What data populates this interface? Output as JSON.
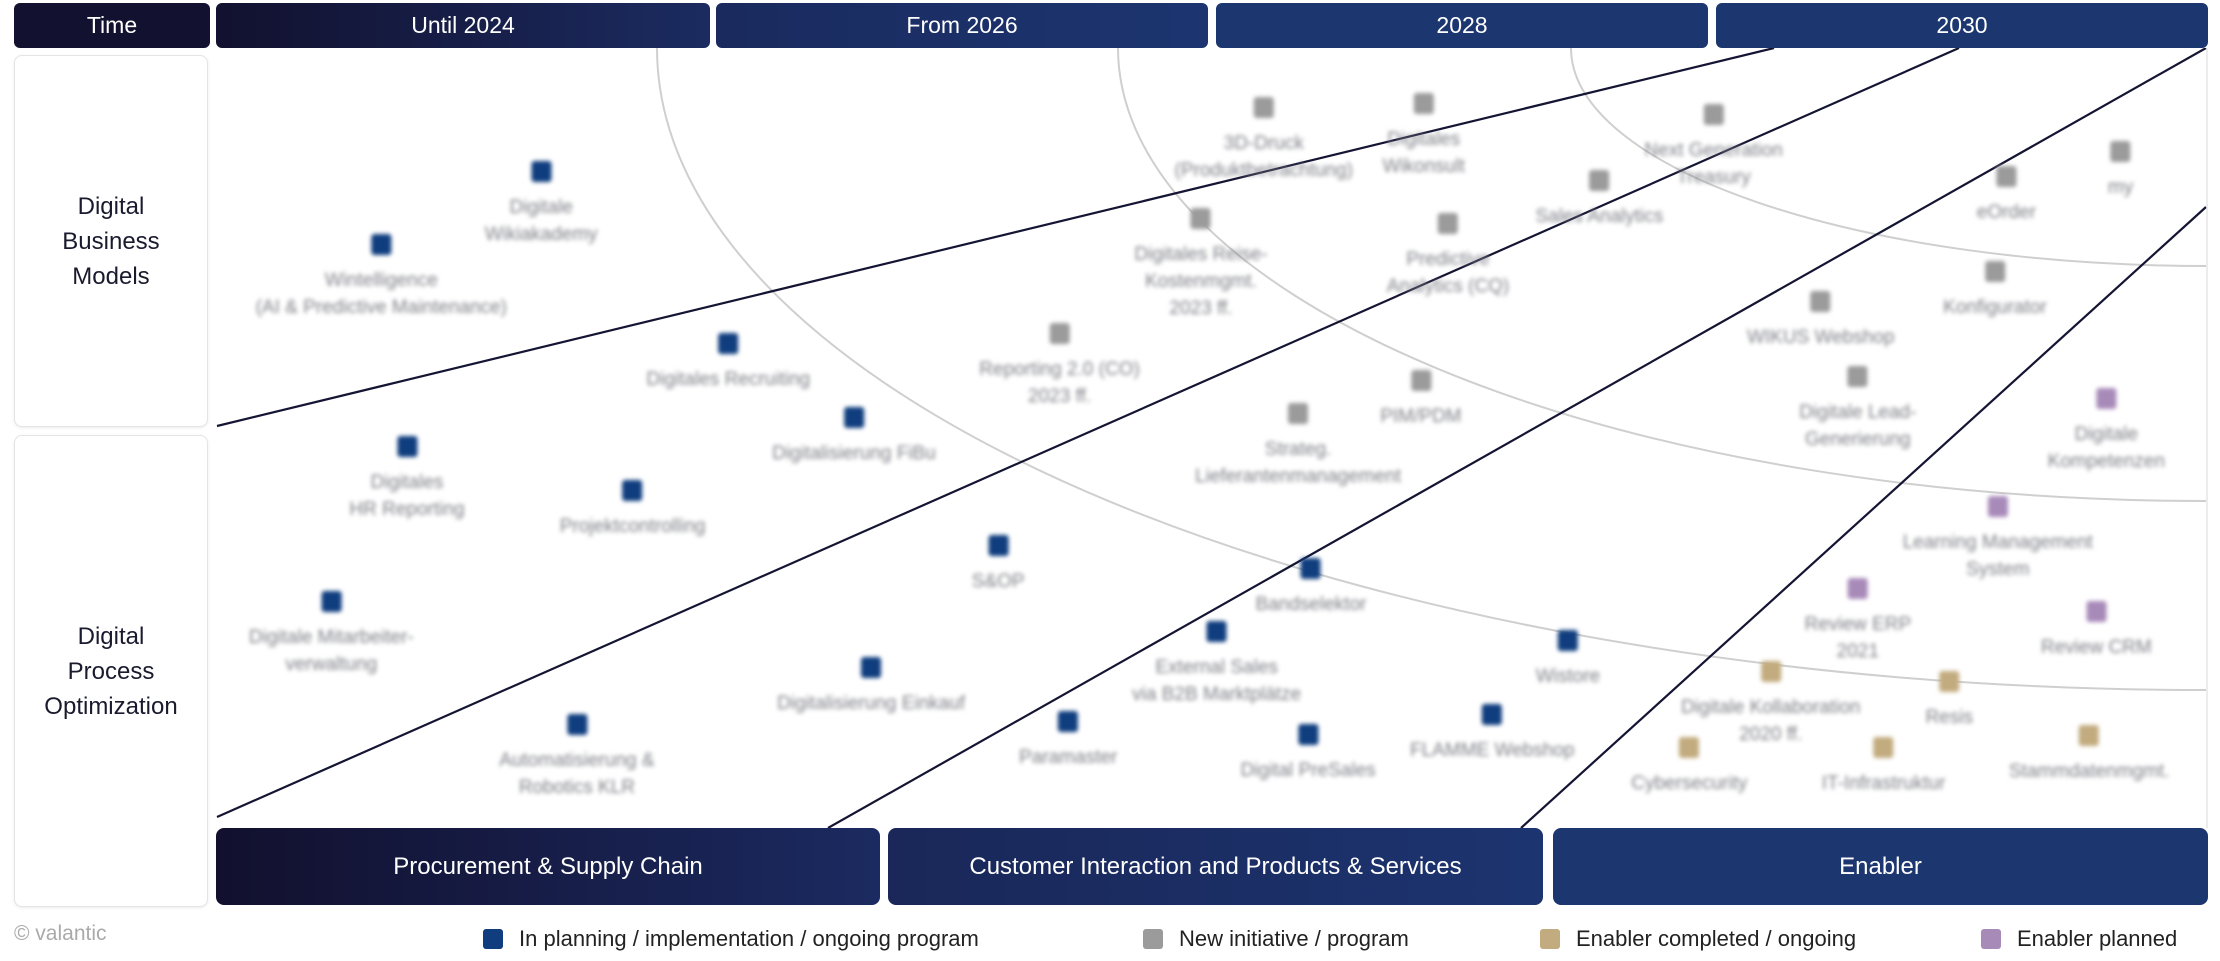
{
  "colors": {
    "planning": "#0f3d7e",
    "new": "#9a9b9a",
    "enabler_done": "#c2ab7e",
    "enabler_planned": "#a88ab9"
  },
  "header": {
    "time_label": "Time",
    "periods": [
      "Until 2024",
      "From 2026",
      "2028",
      "2030"
    ]
  },
  "rows": [
    "Digital\nBusiness\nModels",
    "Digital\nProcess\nOptimization"
  ],
  "areas": [
    "Procurement & Supply Chain",
    "Customer Interaction and Products & Services",
    "Enabler"
  ],
  "items": [
    {
      "label": [
        "Digitale",
        "Wikiakademy"
      ],
      "status": "planning"
    },
    {
      "label": [
        "Wintelligence",
        "(AI & Predictive Maintenance)"
      ],
      "status": "planning"
    },
    {
      "label": [
        "Digitales Recruiting"
      ],
      "status": "planning"
    },
    {
      "label": [
        "Digitalisierung FiBu"
      ],
      "status": "planning"
    },
    {
      "label": [
        "Digitales",
        "HR Reporting"
      ],
      "status": "planning"
    },
    {
      "label": [
        "Projektcontrolling"
      ],
      "status": "planning"
    },
    {
      "label": [
        "S&OP"
      ],
      "status": "planning"
    },
    {
      "label": [
        "Digitale Mitarbeiter-",
        "verwaltung"
      ],
      "status": "planning"
    },
    {
      "label": [
        "Digitalisierung Einkauf"
      ],
      "status": "planning"
    },
    {
      "label": [
        "Automatisierung &",
        "Robotics KLR"
      ],
      "status": "planning"
    },
    {
      "label": [
        "Paramaster"
      ],
      "status": "planning"
    },
    {
      "label": [
        "Bandselektor"
      ],
      "status": "planning"
    },
    {
      "label": [
        "External Sales",
        "via B2B Marktplätze"
      ],
      "status": "planning"
    },
    {
      "label": [
        "Digital PreSales"
      ],
      "status": "planning"
    },
    {
      "label": [
        "FLAMME Webshop"
      ],
      "status": "planning"
    },
    {
      "label": [
        "Wistore"
      ],
      "status": "planning"
    },
    {
      "label": [
        "3D-Druck",
        "(Produktbetrachtung)"
      ],
      "status": "new"
    },
    {
      "label": [
        "Digitales",
        "Wikonsult"
      ],
      "status": "new"
    },
    {
      "label": [
        "Next Generation",
        "Treasury"
      ],
      "status": "new"
    },
    {
      "label": [
        "Sales Analytics"
      ],
      "status": "new"
    },
    {
      "label": [
        "Digitales Reise-",
        "Kostenmgmt.",
        "2023 ff."
      ],
      "status": "new"
    },
    {
      "label": [
        "Predictive",
        "Analytics (CQ)"
      ],
      "status": "new"
    },
    {
      "label": [
        "Reporting 2.0 (CO)",
        "2023 ff."
      ],
      "status": "new"
    },
    {
      "label": [
        "Strateg.",
        "Lieferantenmanagement"
      ],
      "status": "new"
    },
    {
      "label": [
        "PIM/PDM"
      ],
      "status": "new"
    },
    {
      "label": [
        "eOrder"
      ],
      "status": "new"
    },
    {
      "label": [
        "my"
      ],
      "status": "new"
    },
    {
      "label": [
        "Konfigurator"
      ],
      "status": "new"
    },
    {
      "label": [
        "WIKUS Webshop"
      ],
      "status": "new"
    },
    {
      "label": [
        "Digitale Lead-",
        "Generierung"
      ],
      "status": "new"
    },
    {
      "label": [
        "Digitale",
        "Kompetenzen"
      ],
      "status": "enabler_planned"
    },
    {
      "label": [
        "Learning Management",
        "System"
      ],
      "status": "enabler_planned"
    },
    {
      "label": [
        "Review ERP",
        "2021"
      ],
      "status": "enabler_planned"
    },
    {
      "label": [
        "Review CRM"
      ],
      "status": "enabler_planned"
    },
    {
      "label": [
        "Digitale Kollaboration",
        "2020 ff."
      ],
      "status": "enabler_done"
    },
    {
      "label": [
        "Resis"
      ],
      "status": "enabler_done"
    },
    {
      "label": [
        "Cybersecurity"
      ],
      "status": "enabler_done"
    },
    {
      "label": [
        "IT-Infrastruktur"
      ],
      "status": "enabler_done"
    },
    {
      "label": [
        "Stammdatenmgmt."
      ],
      "status": "enabler_done"
    }
  ],
  "legend": [
    {
      "label": "In planning / implementation / ongoing program",
      "status": "planning"
    },
    {
      "label": "New initiative / program",
      "status": "new"
    },
    {
      "label": "Enabler completed / ongoing",
      "status": "enabler_done"
    },
    {
      "label": "Enabler planned",
      "status": "enabler_planned"
    }
  ],
  "copyright": "© valantic"
}
